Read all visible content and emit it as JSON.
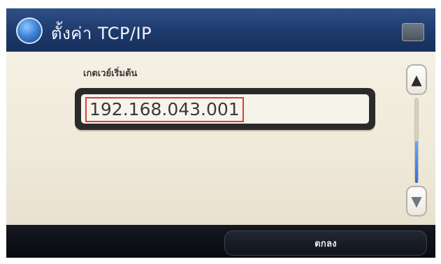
{
  "title_bar": {
    "title": "ตั้งค่า TCP/IP",
    "app_icon": "blue-globe-icon",
    "corner_icon": "window-icon"
  },
  "form": {
    "field_label": "เกตเวย์เริ่มต้น",
    "field_value": "192.168.043.001",
    "selection_color": "#e03a3a"
  },
  "scroll": {
    "up_icon": "▲",
    "down_icon": "▼",
    "thumb_color": "#2f6fda"
  },
  "actions": {
    "ok_label": "ตกลง"
  }
}
